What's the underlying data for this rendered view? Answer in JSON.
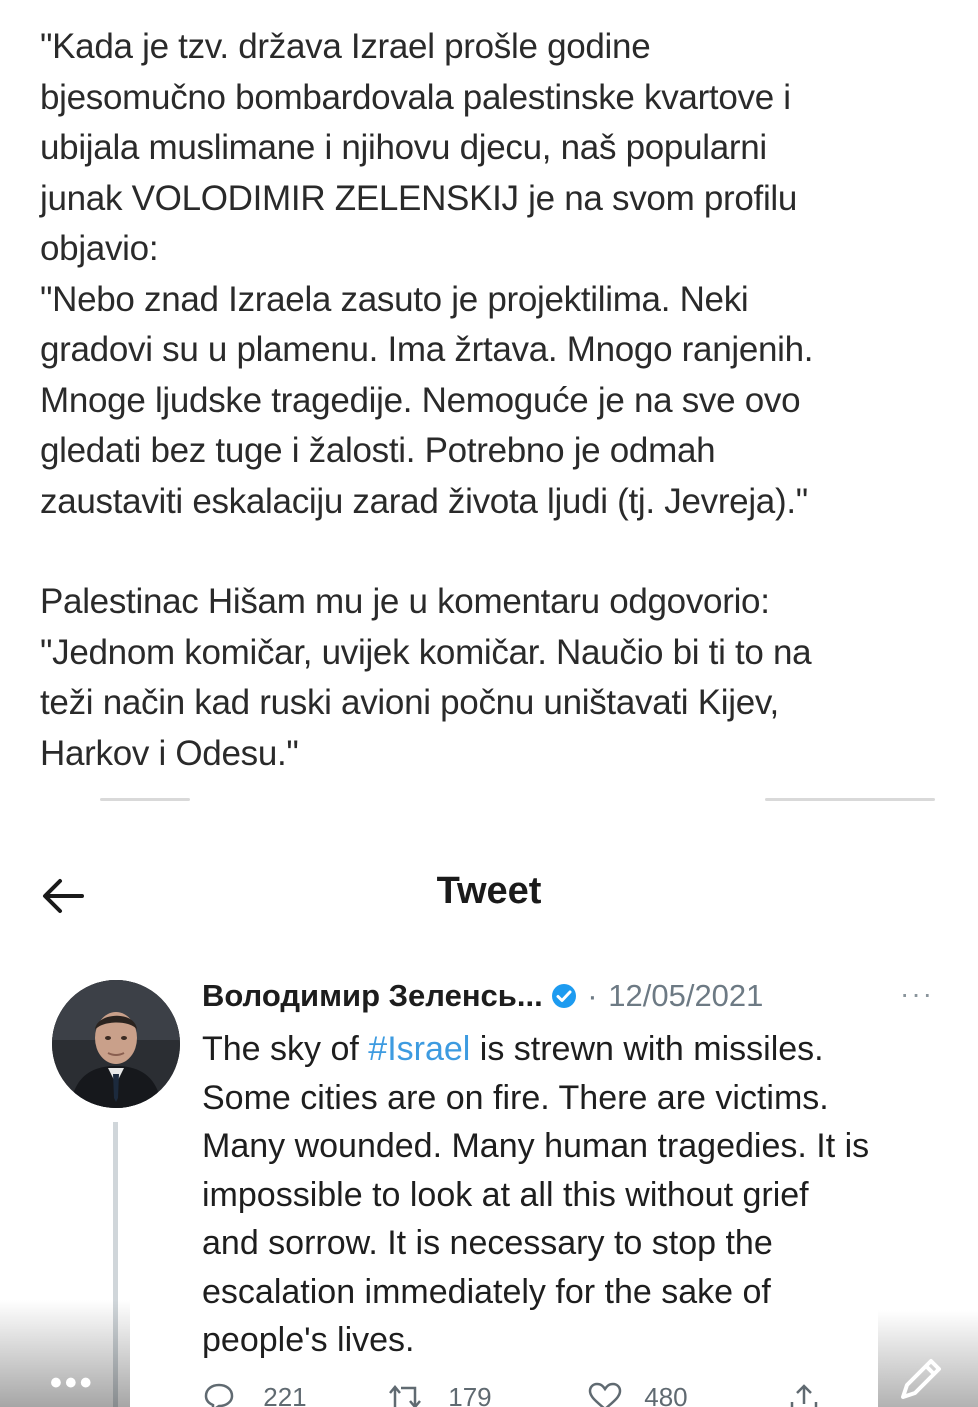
{
  "post": {
    "paragraph1": [
      "\"Kada je tzv. država Izrael prošle godine",
      "bjesomučno bombardovala palestinske kvartove i",
      "ubijala muslimane i njihovu djecu, naš popularni",
      "junak VOLODIMIR ZELENSKIJ je na svom profilu",
      "objavio:",
      "\"Nebo znad Izraela zasuto je projektilima. Neki",
      "gradovi su u plamenu. Ima žrtava. Mnogo ranjenih.",
      "Mnoge ljudske tragedije. Nemoguće je na sve ovo",
      "gledati bez tuge i žalosti. Potrebno je odmah",
      "zaustaviti eskalaciju zarad života ljudi (tj. Jevreja).\""
    ],
    "paragraph2": [
      "Palestinac Hišam mu je u komentaru odgovorio:",
      "\"Jednom komičar, uvijek komičar. Naučio bi ti to na",
      "teži način kad ruski avioni počnu uništavati Kijev,",
      "Harkov i Odesu.\""
    ]
  },
  "header": {
    "title": "Tweet",
    "back_icon": "arrow-left-icon"
  },
  "tweet": {
    "author": "Володимир Зеленсь...",
    "separator": " · ",
    "date": "12/05/2021",
    "more_icon": "ellipsis-icon",
    "verified_icon": "verified-badge-icon",
    "text_before_hashtag": "The sky of ",
    "hashtag": "#Israel",
    "text_after_hashtag": " is strewn with missiles.",
    "lines": [
      "Some cities are on fire. There are victims.",
      "Many wounded. Many human tragedies. It is",
      "impossible to look at all this without grief",
      "and sorrow. It is necessary to stop the",
      "escalation immediately for the sake of",
      "people's lives."
    ],
    "actions": {
      "replies": "221",
      "retweets": "179",
      "likes": "480"
    }
  },
  "colors": {
    "hashtag": "#3d9be0",
    "verified": "#1d9bf0",
    "muted": "#6d7a84"
  }
}
